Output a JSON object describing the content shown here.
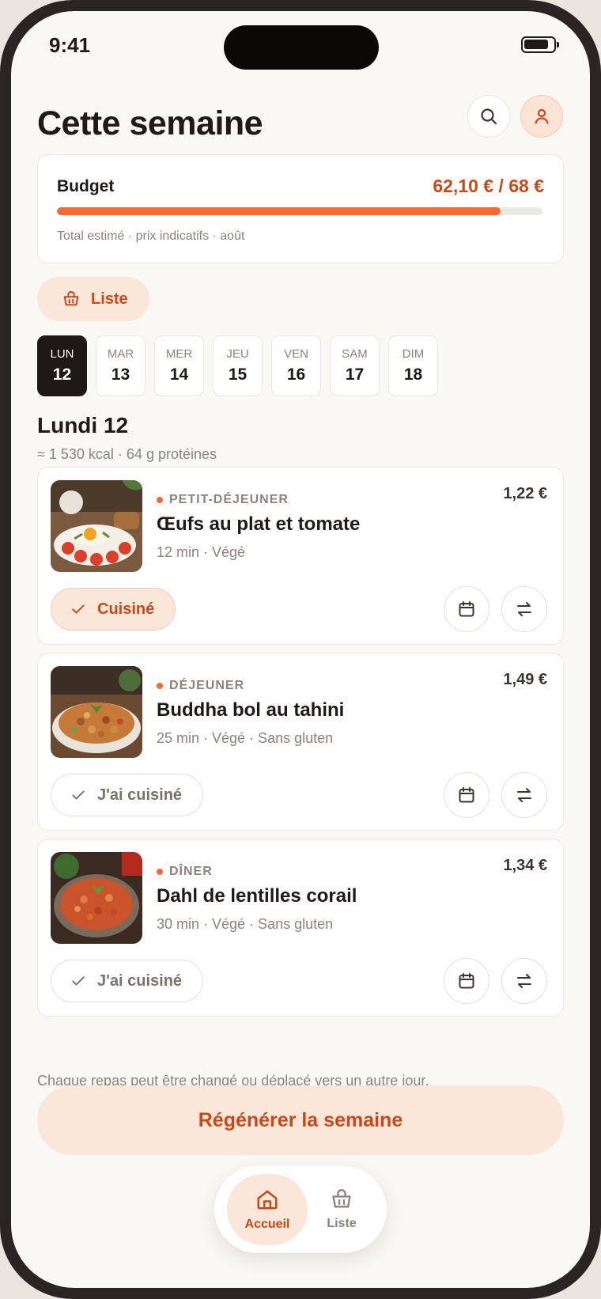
{
  "status": {
    "time": "9:41"
  },
  "header": {
    "title": "Cette semaine"
  },
  "budget": {
    "label": "Budget",
    "value": "62,10 € / 68 €",
    "spent": 62.1,
    "total": 68,
    "note": "Total estimé · prix indicatifs · août",
    "accent": "#f26a35"
  },
  "list_button": {
    "label": "Liste",
    "icon": "basket-icon"
  },
  "days": [
    {
      "name": "LUN",
      "num": "12",
      "active": true
    },
    {
      "name": "MAR",
      "num": "13"
    },
    {
      "name": "MER",
      "num": "14"
    },
    {
      "name": "JEU",
      "num": "15"
    },
    {
      "name": "VEN",
      "num": "16"
    },
    {
      "name": "SAM",
      "num": "17"
    },
    {
      "name": "DIM",
      "num": "18"
    }
  ],
  "day_detail": {
    "title": "Lundi 12",
    "summary": "≈ 1 530 kcal · 64 g protéines"
  },
  "meals": [
    {
      "type": "PETIT-DÉJEUNER",
      "name": "Œufs au plat et tomate",
      "meta": "12 min · Végé",
      "price": "1,22 €",
      "cook_label": "Cuisiné",
      "cooked": true
    },
    {
      "type": "DÉJEUNER",
      "name": "Buddha bol au tahini",
      "meta": "25 min · Végé · Sans gluten",
      "price": "1,49 €",
      "cook_label": "J'ai cuisiné",
      "cooked": false
    },
    {
      "type": "DÎNER",
      "name": "Dahl de lentilles corail",
      "meta": "30 min · Végé · Sans gluten",
      "price": "1,34 €",
      "cook_label": "J'ai cuisiné",
      "cooked": false
    }
  ],
  "footer": {
    "note": "Chaque repas peut être changé ou déplacé vers un autre jour.",
    "regenerate_label": "Régénérer la semaine"
  },
  "tabbar": {
    "home_label": "Accueil",
    "list_label": "Liste"
  }
}
